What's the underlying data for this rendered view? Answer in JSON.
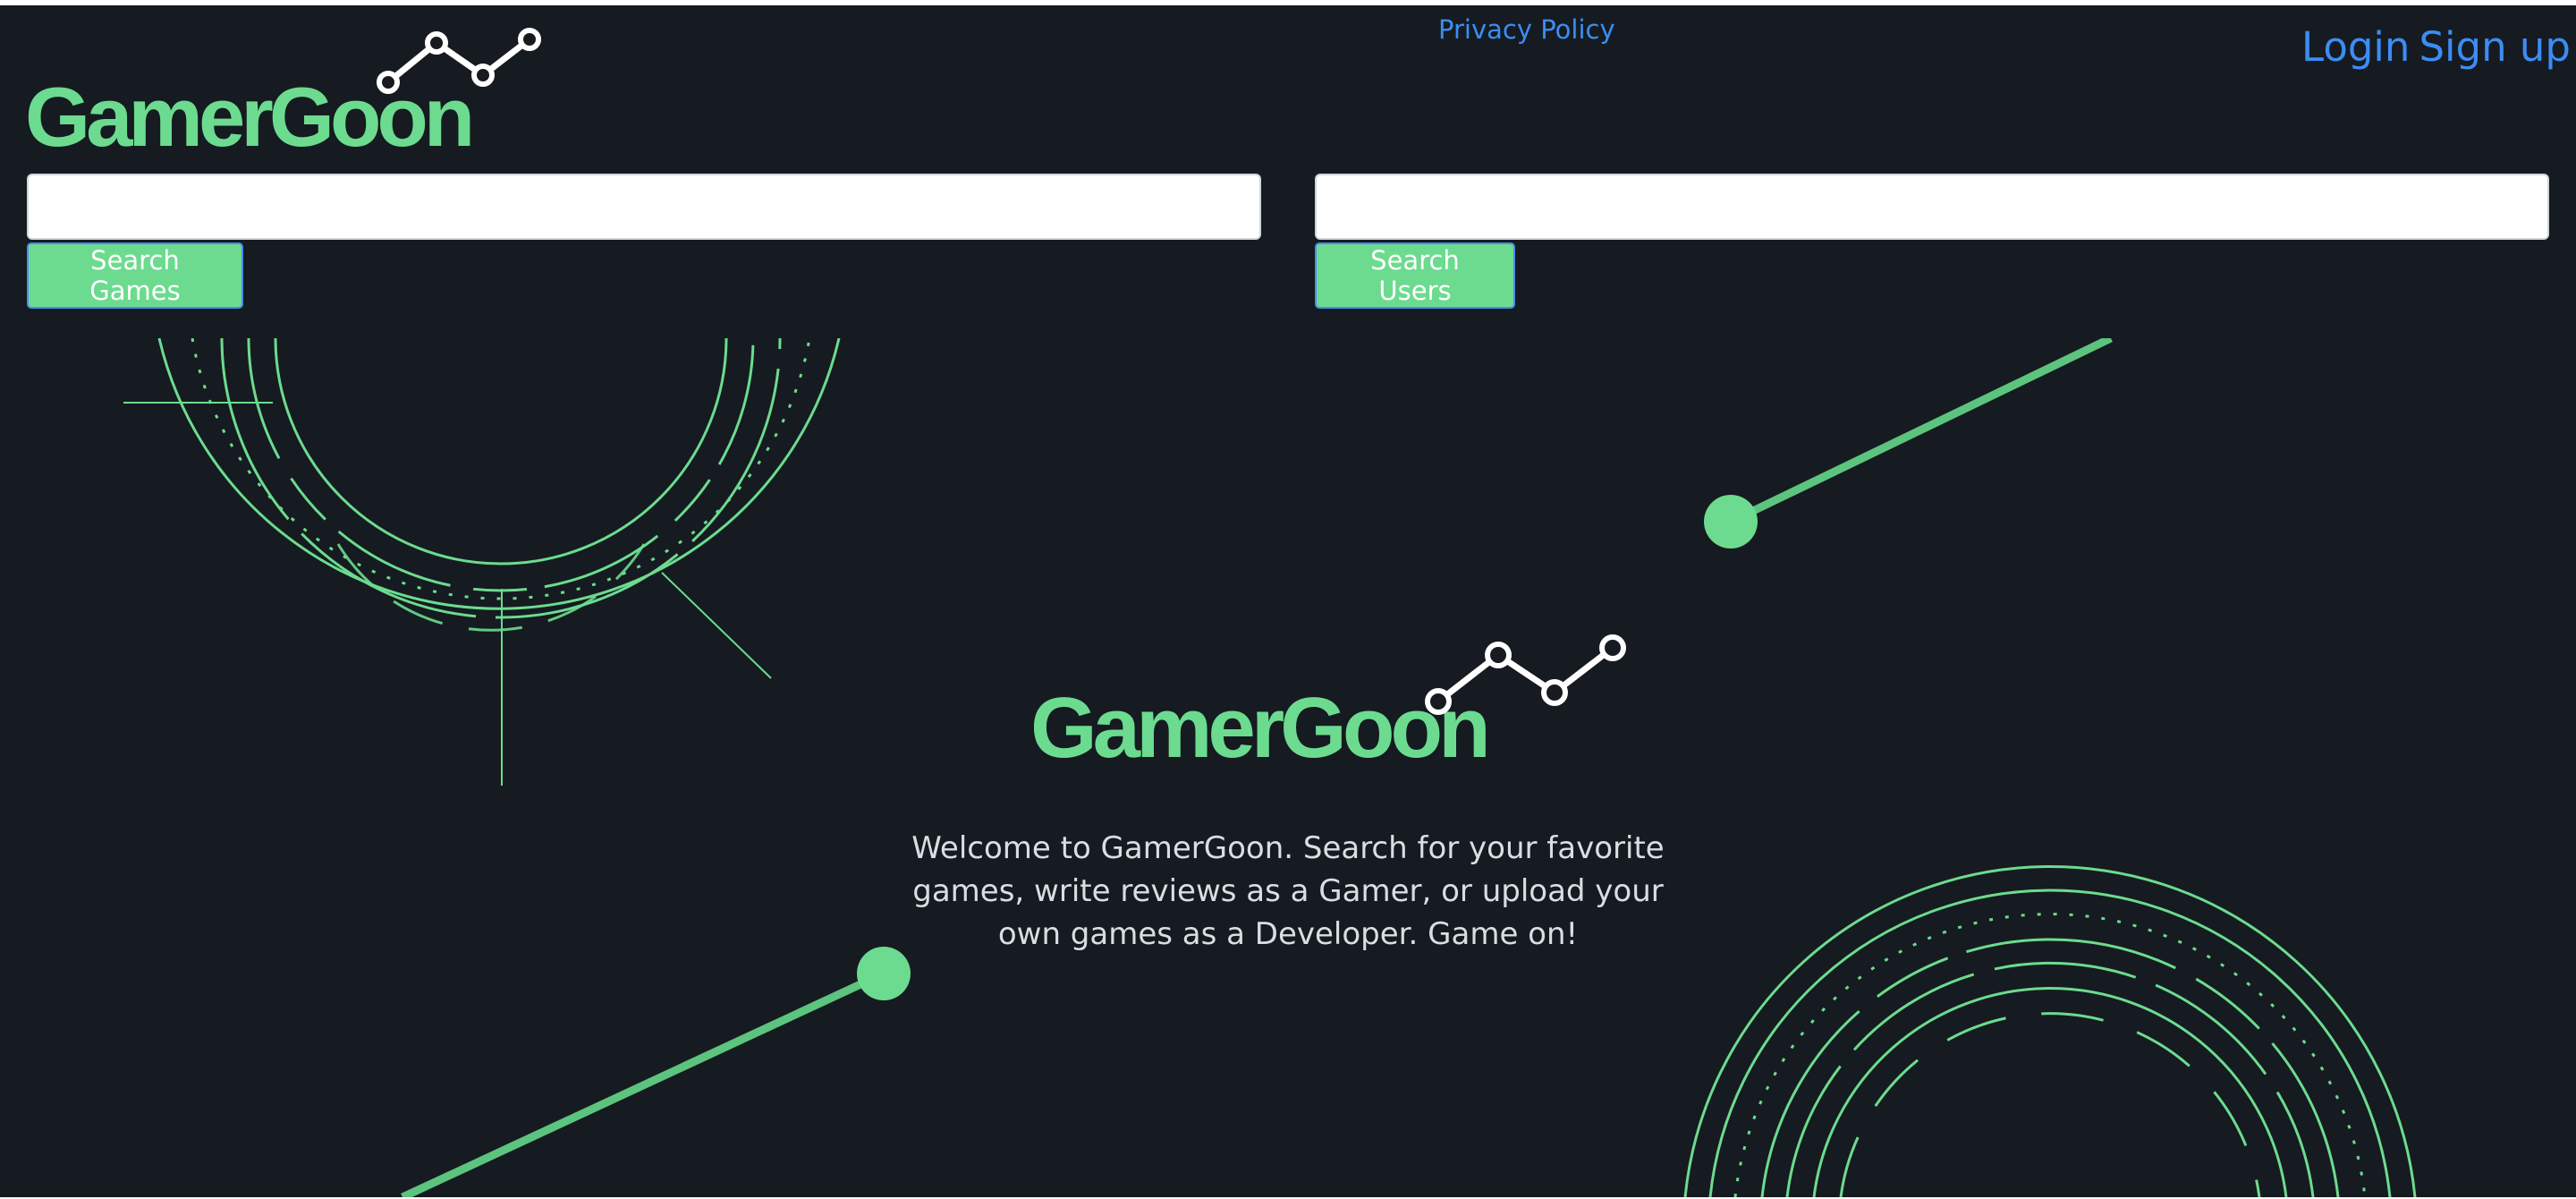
{
  "header": {
    "logo_text": "GamerGoon",
    "privacy_link": "Privacy Policy",
    "login_link": "Login",
    "signup_link": "Sign up"
  },
  "search": {
    "games_button": "Search Games",
    "users_button": "Search Users",
    "games_placeholder": "",
    "users_placeholder": ""
  },
  "hero": {
    "logo_text": "GamerGoon",
    "welcome_text": "Welcome to GamerGoon. Search for your favorite games, write reviews as a Gamer, or upload your own games as a Developer. Game on!"
  },
  "colors": {
    "background": "#151b20",
    "accent_green": "#6cdb8f",
    "link_blue": "#3d8cf5",
    "button_border": "#4b8af0"
  },
  "icons": [
    "logo-graph-icon",
    "ring-ornament-icon",
    "line-dot-ornament-icon"
  ]
}
